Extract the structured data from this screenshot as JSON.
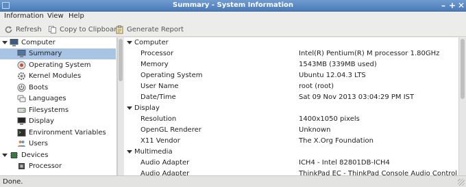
{
  "window": {
    "title": "Summary - System Information",
    "controls": [
      "–",
      "+",
      "✕"
    ]
  },
  "menu": [
    "Information",
    "View",
    "Help"
  ],
  "toolbar": {
    "refresh": "Refresh",
    "copy": "Copy to Clipboard",
    "report": "Generate Report"
  },
  "sidebar": {
    "groups": [
      {
        "label": "Computer",
        "icon": "computer-icon"
      },
      {
        "label": "Devices",
        "icon": "chip-icon"
      }
    ],
    "items": [
      {
        "label": "Summary",
        "icon": "summary-icon",
        "selected": true
      },
      {
        "label": "Operating System",
        "icon": "os-icon"
      },
      {
        "label": "Kernel Modules",
        "icon": "gear-icon"
      },
      {
        "label": "Boots",
        "icon": "power-icon"
      },
      {
        "label": "Languages",
        "icon": "languages-icon"
      },
      {
        "label": "Filesystems",
        "icon": "drive-icon"
      },
      {
        "label": "Display",
        "icon": "display-icon"
      },
      {
        "label": "Environment Variables",
        "icon": "terminal-icon"
      },
      {
        "label": "Users",
        "icon": "users-icon"
      },
      {
        "label": "Processor",
        "icon": "processor-icon"
      }
    ]
  },
  "main": {
    "sections": [
      {
        "title": "Computer",
        "rows": [
          {
            "k": "Processor",
            "v": "Intel(R) Pentium(R) M processor 1.80GHz"
          },
          {
            "k": "Memory",
            "v": "1543MB (339MB used)"
          },
          {
            "k": "Operating System",
            "v": "Ubuntu 12.04.3 LTS"
          },
          {
            "k": "User Name",
            "v": "root (root)"
          },
          {
            "k": "Date/Time",
            "v": "Sat 09 Nov 2013 03:04:29 PM IST"
          }
        ]
      },
      {
        "title": "Display",
        "rows": [
          {
            "k": "Resolution",
            "v": "1400x1050 pixels"
          },
          {
            "k": "OpenGL Renderer",
            "v": "Unknown"
          },
          {
            "k": "X11 Vendor",
            "v": "The X.Org Foundation"
          }
        ]
      },
      {
        "title": "Multimedia",
        "rows": [
          {
            "k": "Audio Adapter",
            "v": "ICH4 - Intel 82801DB-ICH4"
          },
          {
            "k": "Audio Adapter",
            "v": "ThinkPad EC - ThinkPad Console Audio Control"
          }
        ]
      }
    ]
  },
  "status": "Done.",
  "colors": {
    "titlebar": "#5b8bc6",
    "selection": "#a8c4e4"
  }
}
